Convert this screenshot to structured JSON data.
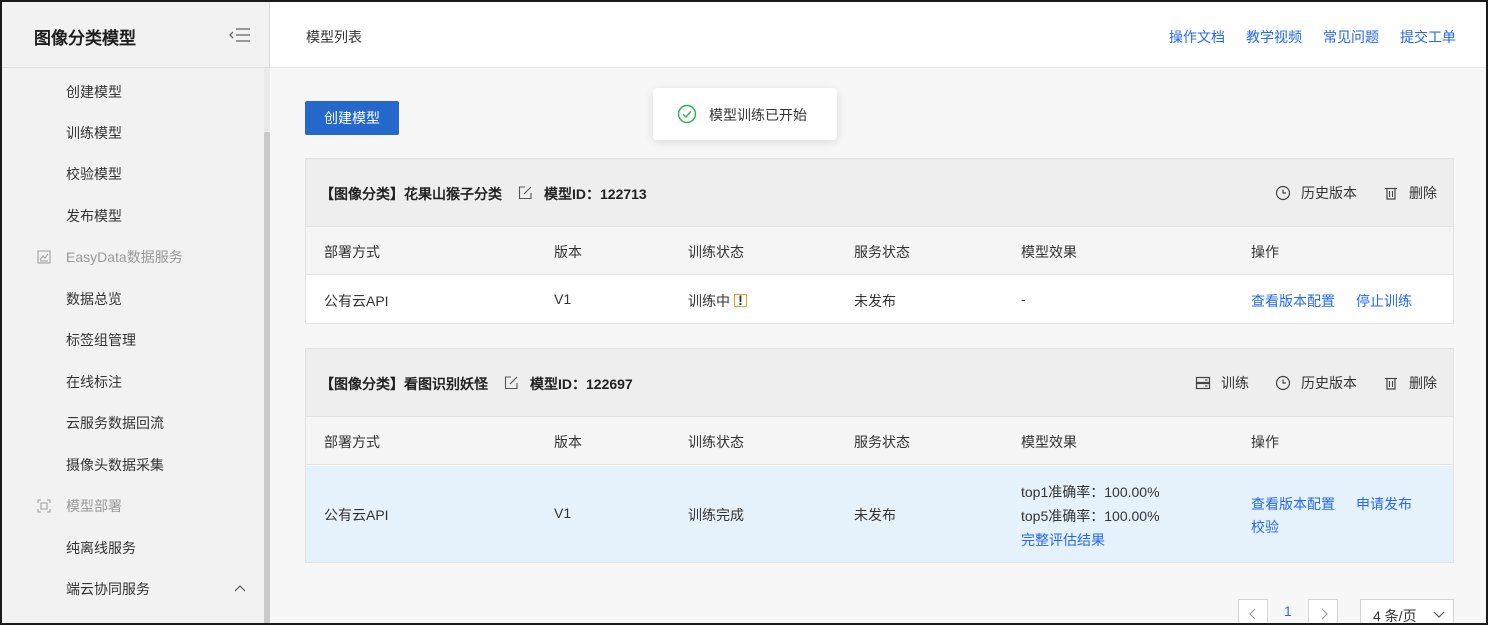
{
  "sidebar": {
    "title": "图像分类模型",
    "items": [
      {
        "label": "创建模型",
        "type": "item"
      },
      {
        "label": "训练模型",
        "type": "item"
      },
      {
        "label": "校验模型",
        "type": "item"
      },
      {
        "label": "发布模型",
        "type": "item"
      },
      {
        "label": "EasyData数据服务",
        "type": "group",
        "icon": "chart-icon"
      },
      {
        "label": "数据总览",
        "type": "item"
      },
      {
        "label": "标签组管理",
        "type": "item"
      },
      {
        "label": "在线标注",
        "type": "item"
      },
      {
        "label": "云服务数据回流",
        "type": "item"
      },
      {
        "label": "摄像头数据采集",
        "type": "item"
      },
      {
        "label": "模型部署",
        "type": "group",
        "icon": "deploy-icon"
      },
      {
        "label": "纯离线服务",
        "type": "item"
      },
      {
        "label": "端云协同服务",
        "type": "item",
        "icon": "chevron-up-icon"
      }
    ]
  },
  "header": {
    "page_title": "模型列表",
    "links": [
      "操作文档",
      "教学视频",
      "常见问题",
      "提交工单"
    ]
  },
  "main": {
    "create_button": "创建模型",
    "toast": "模型训练已开始",
    "columns": [
      "部署方式",
      "版本",
      "训练状态",
      "服务状态",
      "模型效果",
      "操作"
    ],
    "cards": [
      {
        "title": "【图像分类】花果山猴子分类",
        "model_id": "模型ID：122713",
        "actions": [
          "历史版本",
          "删除"
        ],
        "row": {
          "deploy": "公有云API",
          "version": "V1",
          "train_status": "训练中",
          "warn_badge": "!",
          "service_status": "未发布",
          "effect": "-",
          "ops": [
            "查看版本配置",
            "停止训练"
          ]
        }
      },
      {
        "title": "【图像分类】看图识别妖怪",
        "model_id": "模型ID：122697",
        "actions": [
          "训练",
          "历史版本",
          "删除"
        ],
        "row": {
          "deploy": "公有云API",
          "version": "V1",
          "train_status": "训练完成",
          "service_status": "未发布",
          "effect_lines": [
            "top1准确率：100.00%",
            "top5准确率：100.00%"
          ],
          "effect_link": "完整评估结果",
          "ops": [
            "查看版本配置",
            "申请发布",
            "校验"
          ]
        }
      }
    ],
    "pagination": {
      "current_page": "1",
      "page_size": "4 条/页"
    }
  },
  "colors": {
    "accent": "#2468f2",
    "button": "#2468cc",
    "warning": "#f59a23",
    "success": "#2bb24c",
    "highlight_row": "#e6f2fb"
  }
}
